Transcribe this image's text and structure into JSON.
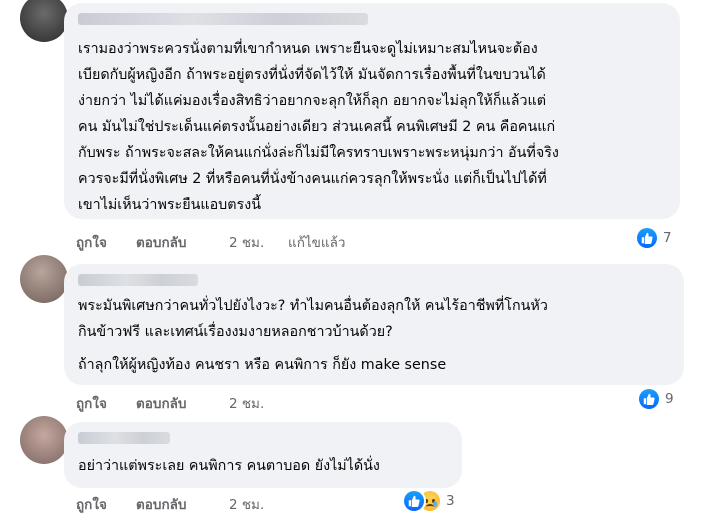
{
  "comments": [
    {
      "lines": [
        "เรามองว่าพระควรนั่งตามที่เขากำหนด เพราะยืนจะดูไม่เหมาะสมไหนจะต้อง",
        "เบียดกับผู้หญิงอีก ถ้าพระอยู่ตรงที่นั่งที่จัดไว้ให้ มันจัดการเรื่องพื้นที่ในขบวนได้",
        "ง่ายกว่า ไม่ได้แค่มองเรื่องสิทธิว่าอยากจะลุกให้ก็ลุก อยากจะไม่ลุกให้ก็แล้วแต่",
        "คน มันไม่ใช่ประเด็นแค่ตรงนั้นอย่างเดียว ส่วนเคสนี้ คนพิเศษมี 2 คน คือคนแก่",
        "กับพระ ถ้าพระจะสละให้คนแก่นั่งล่ะก็ไม่มีใครทราบเพราะพระหนุ่มกว่า อันที่จริง",
        "ควรจะมีที่นั่งพิเศษ 2 ที่หรือคนที่นั่งข้างคนแก่ควรลุกให้พระนั่ง แต่ก็เป็นไปได้ที่",
        "เขาไม่เห็นว่าพระยืนแอบตรงนี้"
      ],
      "like_label": "ถูกใจ",
      "reply_label": "ตอบกลับ",
      "time": "2 ชม.",
      "edited_label": "แก้ไขแล้ว",
      "reaction_count": "7"
    },
    {
      "lines": [
        "พระมันพิเศษกว่าคนทั่วไปยังไงวะ? ทำไมคนอื่นต้องลุกให้ คนไร้อาชีพที่โกนหัว",
        "กินข้าวฟรี และเทศน์เรื่องงมงายหลอกชาวบ้านด้วย?"
      ],
      "lines2": [
        "ถ้าลุกให้ผู้หญิงท้อง คนชรา หรือ คนพิการ ก็ยัง make sense"
      ],
      "like_label": "ถูกใจ",
      "reply_label": "ตอบกลับ",
      "time": "2 ชม.",
      "reaction_count": "9"
    },
    {
      "lines": [
        "อย่าว่าแต่พระเลย คนพิการ คนตาบอด ยังไม่ได้นั่ง"
      ],
      "like_label": "ถูกใจ",
      "reply_label": "ตอบกลับ",
      "time": "2 ชม.",
      "reaction_count": "3"
    }
  ],
  "icons": {
    "like": "like-reaction-icon",
    "sad": "sad-reaction-icon"
  },
  "colors": {
    "bubble": "#f0f2f5",
    "action_text": "#65676b",
    "like_blue": "#0866ff"
  }
}
